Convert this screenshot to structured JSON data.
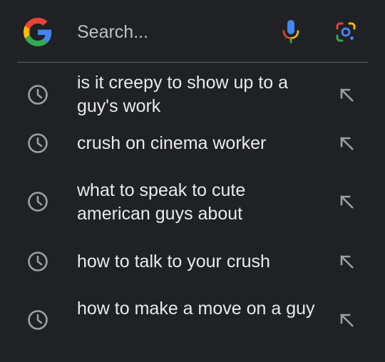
{
  "search": {
    "placeholder": "Search...",
    "value": ""
  },
  "icons": {
    "logo": "google-g-logo",
    "voice": "microphone-icon",
    "lens": "google-lens-icon",
    "history": "history-clock-icon",
    "fill": "north-west-arrow-icon"
  },
  "colors": {
    "background": "#202124",
    "text": "#e8eaed",
    "icon": "#9aa0a6",
    "google_blue": "#4285f4",
    "google_red": "#ea4335",
    "google_yellow": "#fbbc05",
    "google_green": "#34a853"
  },
  "suggestions": [
    {
      "text": "is it creepy to show up to a guy's work"
    },
    {
      "text": "crush on cinema worker"
    },
    {
      "text": "what to speak to cute american guys about"
    },
    {
      "text": "how to talk to your crush"
    },
    {
      "text": "how to make a move on a guy"
    }
  ]
}
